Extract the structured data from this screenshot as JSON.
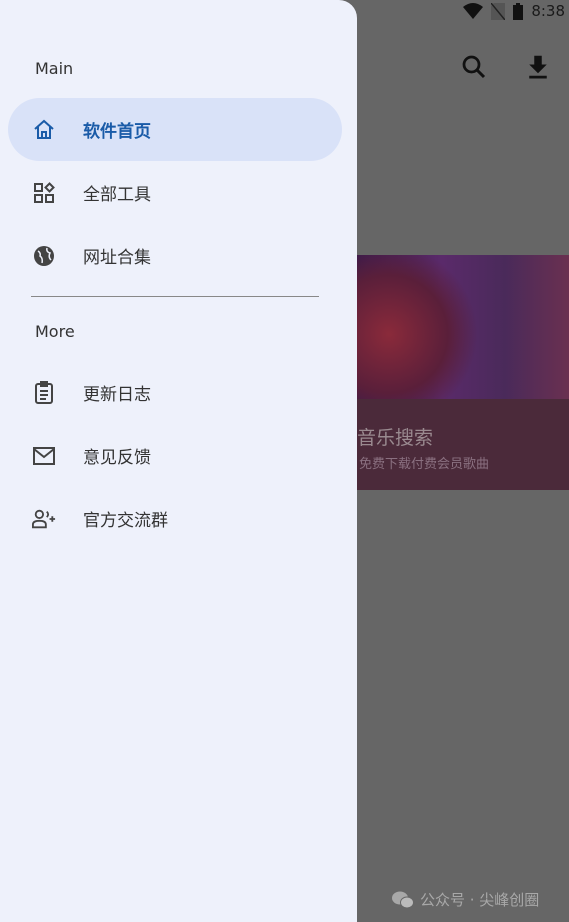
{
  "status_bar": {
    "time": "8:38"
  },
  "app_bar": {
    "search_icon": "search-icon",
    "download_icon": "download-icon"
  },
  "banner": {
    "title": "音乐搜索",
    "subtitle": "免费下载付费会员歌曲"
  },
  "drawer": {
    "sections": [
      {
        "title": "Main",
        "items": [
          {
            "label": "软件首页",
            "icon": "home-icon",
            "active": true
          },
          {
            "label": "全部工具",
            "icon": "widgets-icon"
          },
          {
            "label": "网址合集",
            "icon": "globe-icon"
          }
        ]
      },
      {
        "title": "More",
        "items": [
          {
            "label": "更新日志",
            "icon": "clipboard-icon"
          },
          {
            "label": "意见反馈",
            "icon": "mail-icon"
          },
          {
            "label": "官方交流群",
            "icon": "group-add-icon"
          }
        ]
      }
    ],
    "accent": "#1a5ba8"
  },
  "watermark": "公众号 · 尖峰创圈"
}
